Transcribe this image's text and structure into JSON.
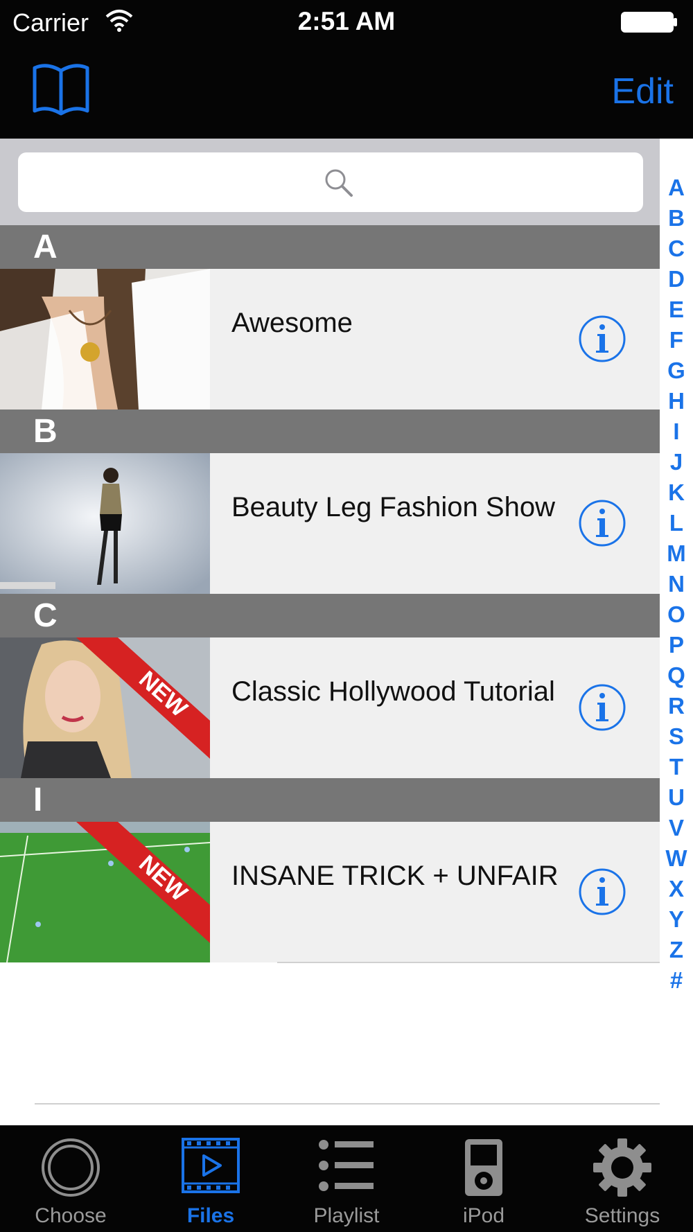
{
  "status_bar": {
    "carrier": "Carrier",
    "time": "2:51 AM"
  },
  "nav_bar": {
    "left_icon": "book-icon",
    "edit_label": "Edit"
  },
  "search": {
    "placeholder": ""
  },
  "sections": [
    {
      "letter": "A",
      "title": "Awesome",
      "thumb": "woman-white-top",
      "badge": ""
    },
    {
      "letter": "B",
      "title": "Beauty Leg Fashion Show",
      "thumb": "woman-black-shorts",
      "badge": ""
    },
    {
      "letter": "C",
      "title": "Classic Hollywood Tutorial",
      "thumb": "woman-blonde",
      "badge": "NEW"
    },
    {
      "letter": "I",
      "title": "INSANE TRICK + UNFAIR",
      "thumb": "soccer-field",
      "badge": "NEW"
    }
  ],
  "index_letters": [
    "A",
    "B",
    "C",
    "D",
    "E",
    "F",
    "G",
    "H",
    "I",
    "J",
    "K",
    "L",
    "M",
    "N",
    "O",
    "P",
    "Q",
    "R",
    "S",
    "T",
    "U",
    "V",
    "W",
    "X",
    "Y",
    "Z",
    "#"
  ],
  "tabs": [
    {
      "label": "Choose",
      "icon": "circle-icon",
      "active": false
    },
    {
      "label": "Files",
      "icon": "film-play-icon",
      "active": true
    },
    {
      "label": "Playlist",
      "icon": "list-icon",
      "active": false
    },
    {
      "label": "iPod",
      "icon": "ipod-icon",
      "active": false
    },
    {
      "label": "Settings",
      "icon": "gear-icon",
      "active": false
    }
  ],
  "colors": {
    "accent": "#1a73e8",
    "section_header": "#767676",
    "row_bg": "#f0f0f0",
    "badge_red": "#d62222"
  }
}
